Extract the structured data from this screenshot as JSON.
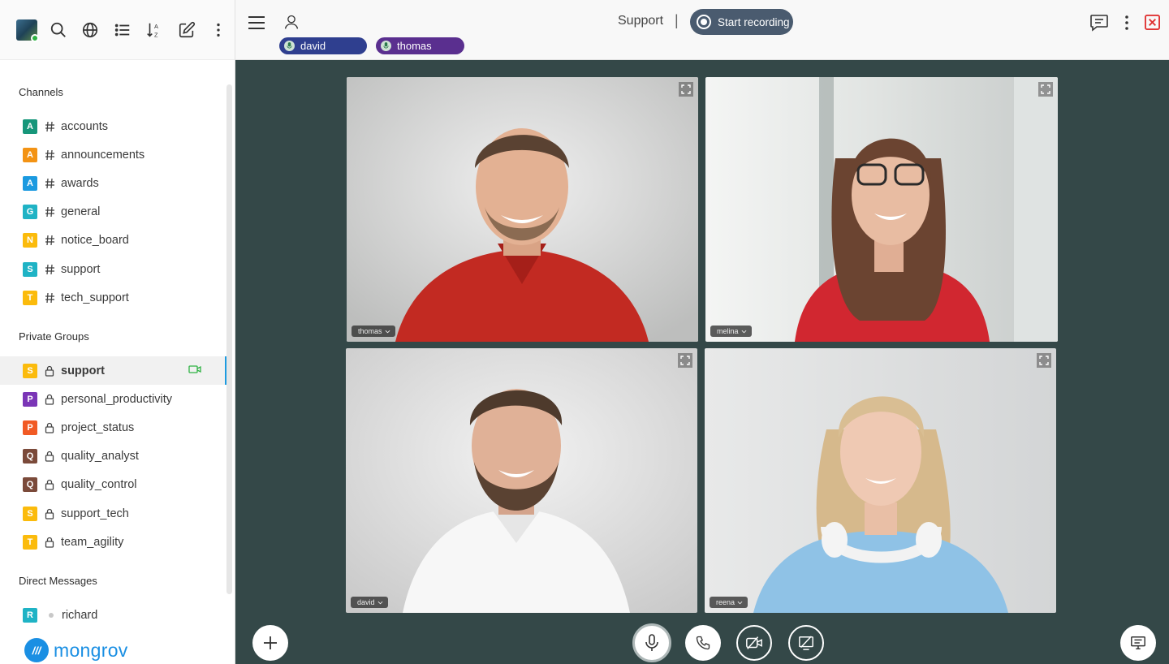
{
  "sidebar": {
    "sections": {
      "channels": "Channels",
      "private_groups": "Private Groups",
      "direct_messages": "Direct Messages"
    },
    "channels": [
      {
        "letter": "A",
        "color": "#16967a",
        "label": "accounts"
      },
      {
        "letter": "A",
        "color": "#f39314",
        "label": "announcements"
      },
      {
        "letter": "A",
        "color": "#1b9ae0",
        "label": "awards"
      },
      {
        "letter": "G",
        "color": "#1fb3c5",
        "label": "general"
      },
      {
        "letter": "N",
        "color": "#fbbb0c",
        "label": "notice_board"
      },
      {
        "letter": "S",
        "color": "#1fb3c5",
        "label": "support"
      },
      {
        "letter": "T",
        "color": "#fbbb0c",
        "label": "tech_support"
      }
    ],
    "private_groups": [
      {
        "letter": "S",
        "color": "#fbbb0c",
        "label": "support",
        "active": true
      },
      {
        "letter": "P",
        "color": "#7a35b6",
        "label": "personal_productivity"
      },
      {
        "letter": "P",
        "color": "#f15a24",
        "label": "project_status"
      },
      {
        "letter": "Q",
        "color": "#7b4a3a",
        "label": "quality_analyst"
      },
      {
        "letter": "Q",
        "color": "#7b4a3a",
        "label": "quality_control"
      },
      {
        "letter": "S",
        "color": "#fbbb0c",
        "label": "support_tech"
      },
      {
        "letter": "T",
        "color": "#fbbb0c",
        "label": "team_agility"
      }
    ],
    "direct_messages": [
      {
        "letter": "R",
        "color": "#1fb3c5",
        "label": "richard"
      }
    ],
    "brand": {
      "logo_glyph": "///",
      "name": "mongrov"
    }
  },
  "call": {
    "room_title": "Support",
    "separator": "|",
    "record_label": "Start recording",
    "speakers": [
      {
        "name": "david",
        "color": "#2f3f8f"
      },
      {
        "name": "thomas",
        "color": "#5a2f8f"
      }
    ],
    "tiles": [
      {
        "name": "thomas"
      },
      {
        "name": "melina"
      },
      {
        "name": "david"
      },
      {
        "name": "reena"
      }
    ]
  },
  "icons": {
    "top_toolbar": [
      "search-icon",
      "globe-icon",
      "list-icon",
      "sort-icon",
      "compose-icon",
      "more-icon"
    ],
    "call_controls": [
      "add-icon",
      "mic-icon",
      "phone-icon",
      "camera-off-icon",
      "screen-share-off-icon",
      "chat-panel-icon"
    ]
  }
}
